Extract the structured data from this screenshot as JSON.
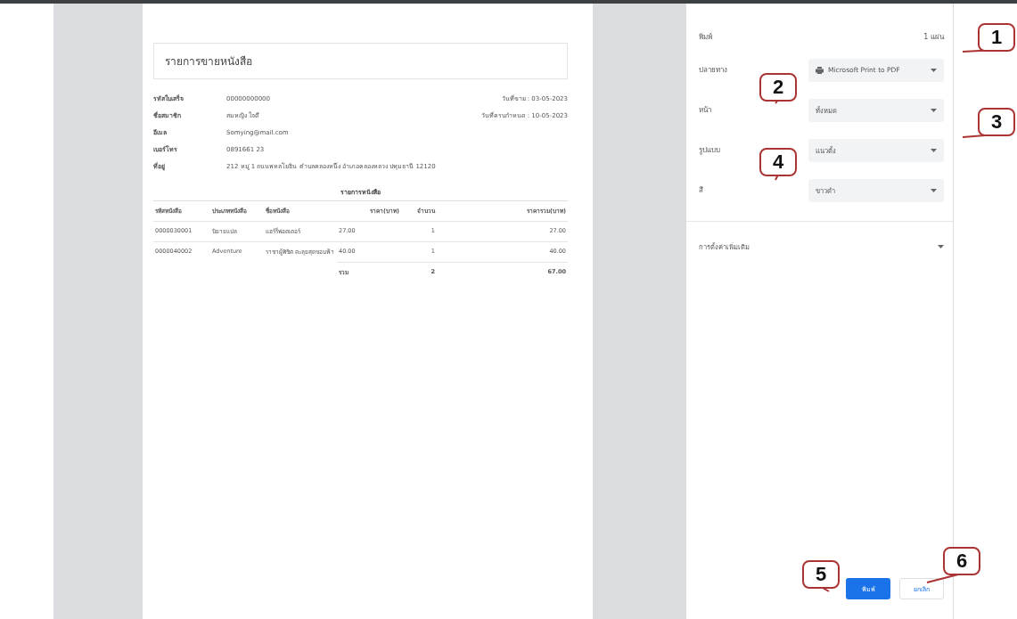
{
  "document": {
    "title": "รายการขายหนังสือ",
    "fields": [
      {
        "label": "รหัสใบเสร็จ",
        "value": "00000000000",
        "note": "วันที่ขาย : 03-05-2023"
      },
      {
        "label": "ชื่อสมาชิก",
        "value": "สมหญิง ใจดี",
        "note": "วันที่ครบกำหนด : 10-05-2023"
      },
      {
        "label": "อีเมล",
        "value": "Somying@mail.com"
      },
      {
        "label": "เบอร์โทร",
        "value": "0891661 23"
      },
      {
        "label": "ที่อยู่",
        "value": "212 หมู่ 1 ถนนพหลโยธิน ตำบลคลองหนึ่ง อำเภอคลองหลวง ปทุมธานี 12120"
      }
    ],
    "table": {
      "title": "รายการหนังสือ",
      "columns": [
        "รหัสหนังสือ",
        "ประเภทหนังสือ",
        "ชื่อหนังสือ",
        "ราคา(บาท)",
        "จำนวน",
        "ราคารวม(บาท)"
      ],
      "rows": [
        [
          "0000030001",
          "นิยายแปล",
          "แฮร์รี่พอตเตอร์",
          "27.00",
          "1",
          "27.00"
        ],
        [
          "0000040002",
          "Adventure",
          "ราชาผู้พิชิต ตะลุยสุดขอบฟ้า",
          "40.00",
          "1",
          "40.00"
        ]
      ],
      "total": {
        "label": "รวม",
        "quantity": "2",
        "amount": "67.00"
      }
    }
  },
  "panel": {
    "title": "พิมพ์",
    "sheets": "1 แผ่น",
    "settings": [
      {
        "kind": "printer",
        "label": "ปลายทาง",
        "value": "Microsoft Print to PDF"
      },
      {
        "kind": "select",
        "label": "หน้า",
        "value": "ทั้งหมด"
      },
      {
        "kind": "select",
        "label": "รูปแบบ",
        "value": "แนวตั้ง"
      },
      {
        "kind": "select",
        "label": "สี",
        "value": "ขาวดำ"
      }
    ],
    "more": "การตั้งค่าเพิ่มเติม",
    "buttons": [
      {
        "kind": "primary",
        "label": "พิมพ์"
      },
      {
        "kind": "secondary",
        "label": "ยกเลิก"
      }
    ]
  },
  "callouts": [
    {
      "number": "1"
    },
    {
      "number": "2"
    },
    {
      "number": "3"
    },
    {
      "number": "4"
    },
    {
      "number": "5"
    },
    {
      "number": "6"
    }
  ]
}
